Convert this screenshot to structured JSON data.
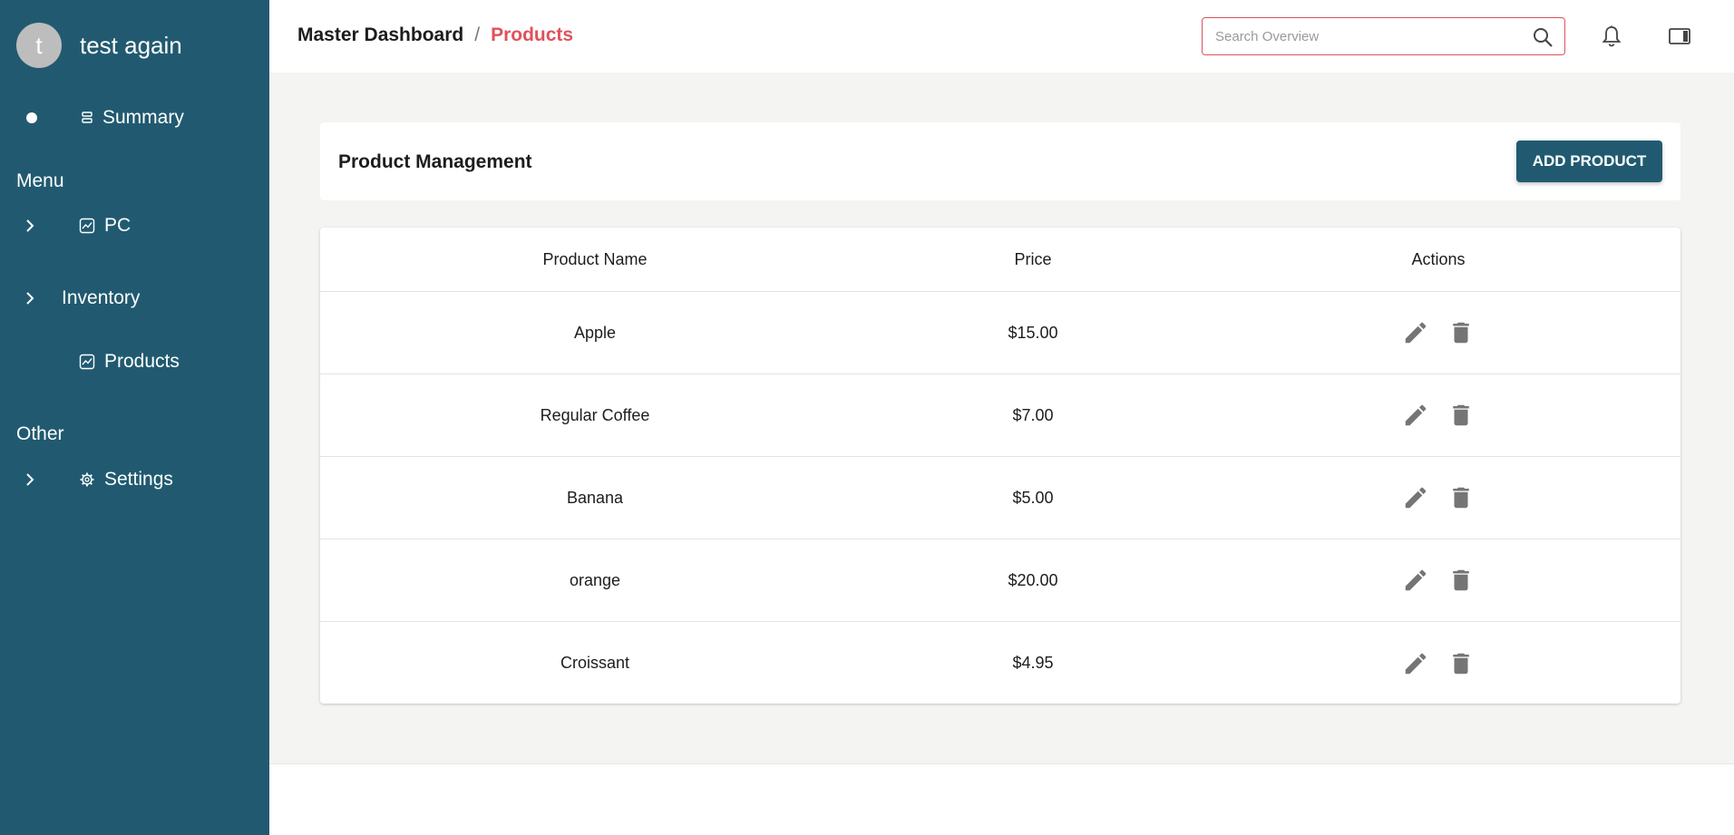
{
  "sidebar": {
    "avatar_initial": "t",
    "user_name": "test again",
    "summary_label": "Summary",
    "menu_heading": "Menu",
    "pc_label": "PC",
    "inventory_label": "Inventory",
    "products_label": "Products",
    "other_heading": "Other",
    "settings_label": "Settings"
  },
  "header": {
    "breadcrumb_root": "Master Dashboard",
    "breadcrumb_sep": "/",
    "breadcrumb_current": "Products",
    "search_placeholder": "Search Overview"
  },
  "page": {
    "title": "Product Management",
    "add_button_label": "ADD PRODUCT"
  },
  "table": {
    "columns": [
      "Product Name",
      "Price",
      "Actions"
    ],
    "rows": [
      {
        "name": "Apple",
        "price": "$15.00"
      },
      {
        "name": "Regular Coffee",
        "price": "$7.00"
      },
      {
        "name": "Banana",
        "price": "$5.00"
      },
      {
        "name": "orange",
        "price": "$20.00"
      },
      {
        "name": "Croissant",
        "price": "$4.95"
      }
    ]
  },
  "colors": {
    "sidebar_bg": "#215a70",
    "accent": "#e0525b",
    "main_bg": "#f4f4f2",
    "icon_gray": "#757575"
  },
  "icons": {
    "search": "search-icon",
    "notifications": "bell-icon",
    "panel": "sidebar-panel-icon",
    "edit": "pencil-icon",
    "delete": "trash-icon"
  }
}
